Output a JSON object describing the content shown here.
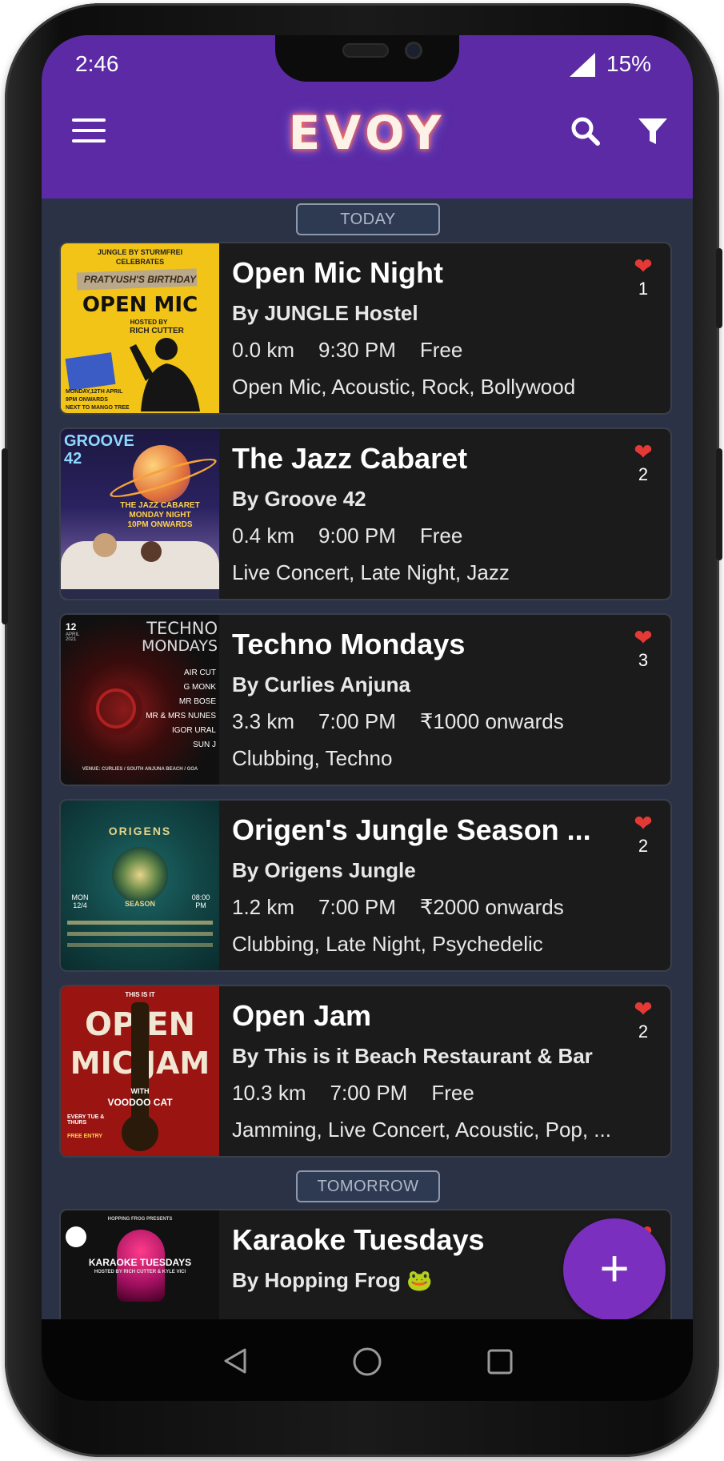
{
  "status": {
    "time": "2:46",
    "battery": "15%"
  },
  "header": {
    "logo": "EVOY"
  },
  "sections": {
    "today": "TODAY",
    "tomorrow": "TOMORROW"
  },
  "events": [
    {
      "title": "Open Mic Night",
      "host": "By JUNGLE Hostel",
      "distance": "0.0 km",
      "time": "9:30 PM",
      "price": "Free",
      "tags": "Open Mic, Acoustic, Rock, Bollywood",
      "likes": "1",
      "poster": {
        "top": "JUNGLE BY STURMFREI",
        "sub": "CELEBRATES",
        "name": "PRATYUSH'S BIRTHDAY",
        "main": "OPEN MIC",
        "hosted": "HOSTED BY",
        "by": "RICH CUTTER",
        "date": "MONDAY,12TH APRIL",
        "time": "9PM ONWARDS",
        "loc": "NEXT TO MANGO TREE"
      }
    },
    {
      "title": "The Jazz Cabaret",
      "host": "By Groove 42",
      "distance": "0.4 km",
      "time": "9:00 PM",
      "price": "Free",
      "tags": "Live Concert, Late Night, Jazz",
      "likes": "2",
      "poster": {
        "brand": "GROOVE 42",
        "line1": "THE JAZZ CABARET",
        "line2": "MONDAY NIGHT",
        "line3": "10PM ONWARDS"
      }
    },
    {
      "title": "Techno Mondays",
      "host": "By Curlies Anjuna",
      "distance": "3.3 km",
      "time": "7:00 PM",
      "price": "₹1000 onwards",
      "tags": "Clubbing, Techno",
      "likes": "3",
      "poster": {
        "date": "12",
        "month": "APRIL 2021",
        "main1": "TECHNO",
        "main2": "MONDAYS",
        "artists": [
          "AIR CUT",
          "G MONK",
          "MR BOSE",
          "MR & MRS NUNES",
          "IGOR URAL",
          "SUN J"
        ],
        "venue": "VENUE: CURLIES / SOUTH ANJUNA BEACH / GOA"
      }
    },
    {
      "title": "Origen's Jungle Season ...",
      "host": "By Origens Jungle",
      "distance": "1.2 km",
      "time": "7:00 PM",
      "price": "₹2000 onwards",
      "tags": "Clubbing, Late Night, Psychedelic",
      "likes": "2",
      "poster": {
        "main": "ORIGENS",
        "sub": "SEASON",
        "day": "MON 12/4",
        "hour": "08:00 PM"
      }
    },
    {
      "title": "Open Jam",
      "host": "By This is it Beach Restaurant & Bar",
      "distance": "10.3 km",
      "time": "7:00 PM",
      "price": "Free",
      "tags": "Jamming, Live Concert, Acoustic, Pop, ...",
      "likes": "2",
      "poster": {
        "top": "THIS IS IT",
        "l1": "OP EN",
        "l2": "MIC JAM",
        "with": "WITH",
        "band": "VOODOO CAT",
        "days": "EVERY TUE & THURS",
        "entry": "FREE ENTRY"
      }
    },
    {
      "title": "Karaoke Tuesdays",
      "host": "By Hopping Frog 🐸",
      "likes": "",
      "poster": {
        "top": "HOPPING FROG PRESENTS",
        "main": "KARAOKE TUESDAYS",
        "sub": "HOSTED BY RICH CUTTER & KYLE VICI"
      }
    }
  ],
  "colors": {
    "appbar": "#5b2aa4",
    "background": "#2b3245",
    "card": "#1b1b1b",
    "fab": "#7b2fbf",
    "heart": "#e53935"
  }
}
